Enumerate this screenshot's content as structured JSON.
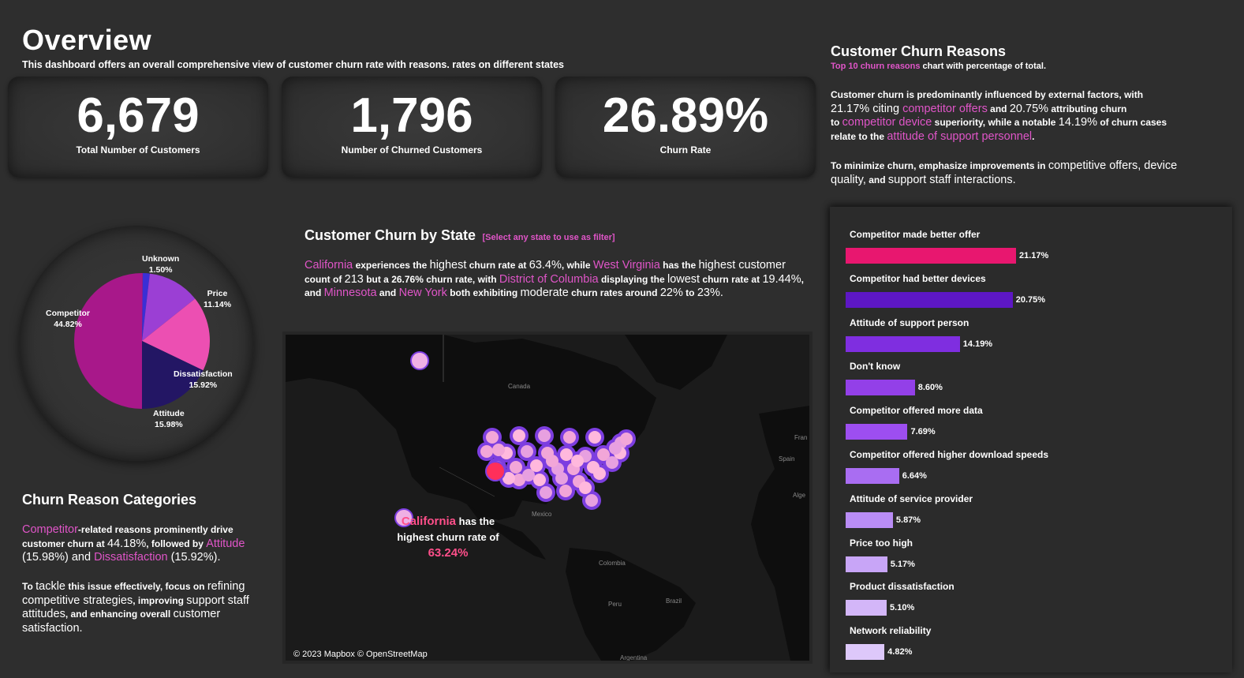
{
  "header": {
    "title": "Overview",
    "subtitle": "This dashboard offers an overall comprehensive view of customer churn rate with reasons. rates on different states"
  },
  "kpis": [
    {
      "value": "6,679",
      "label": "Total Number of Customers"
    },
    {
      "value": "1,796",
      "label": "Number of Churned Customers"
    },
    {
      "value": "26.89%",
      "label": "Churn Rate"
    }
  ],
  "pie": {
    "slices": [
      {
        "name": "Unknown",
        "pct": "1.50%",
        "value": 1.5,
        "color": "#3a2fd6"
      },
      {
        "name": "Price",
        "pct": "11.14%",
        "value": 11.14,
        "color": "#9b3fd4"
      },
      {
        "name": "Dissatisfaction",
        "pct": "15.92%",
        "value": 15.92,
        "color": "#ec4fb2"
      },
      {
        "name": "Attitude",
        "pct": "15.98%",
        "value": 15.98,
        "color": "#231664"
      },
      {
        "name": "Competitor",
        "pct": "44.82%",
        "value": 44.82,
        "color": "#a8188a"
      }
    ]
  },
  "categories": {
    "title": "Churn Reason Categories",
    "p1": {
      "a": "Competitor",
      "b": "-related reasons prominently drive customer churn at ",
      "c": "44.18%",
      "d": ", followed by ",
      "e": "Attitude",
      "f": " (15.98%) and ",
      "g": "Dissatisfaction",
      "h": " (15.92%)."
    },
    "p2": {
      "a": "To ",
      "b": "tackle",
      "c": " this issue effectively, focus on ",
      "d": "refining competitive strategies",
      "e": ", improving ",
      "f": "support staff attitudes",
      "g": ", and enhancing overall ",
      "h": "customer satisfaction."
    }
  },
  "state": {
    "title": "Customer Churn by State",
    "filter_hint": "[Select any state to use as filter]",
    "p": {
      "a": "California",
      "b": " experiences the ",
      "c": "highest",
      "d": " churn rate at ",
      "e": "63.4%",
      "f": ", while ",
      "g": "West Virginia",
      "h": " has the ",
      "i": "highest customer",
      "j": "count of ",
      "k": "213",
      "l": " but a 26.76% churn rate, with ",
      "m": "District of Columbia",
      "n": " displaying the ",
      "o": "lowest",
      "p": " churn rate at ",
      "q": "19.44%",
      "r": ",",
      "s": "and ",
      "t": "Minnesota",
      "u": " and ",
      "v": "New York",
      "w": " both exhibiting ",
      "x": "moderate",
      "y": " churn rates around ",
      "z": "22%",
      "aa": " to ",
      "ab": "23%."
    }
  },
  "map": {
    "annotation_state": "California",
    "annotation_l1": " has the",
    "annotation_l2": "highest churn rate of",
    "annotation_value": "63.24%",
    "credit": "© 2023 Mapbox  © OpenStreetMap",
    "place_labels": [
      "Canada",
      "Mexico",
      "Colombia",
      "Peru",
      "Brazil",
      "Argentina",
      "Spain",
      "Fran",
      "Alge"
    ]
  },
  "reasons": {
    "title": "Customer Churn Reasons",
    "sub_a": "Top 10 churn reasons",
    "sub_b": " chart with percentage of total.",
    "p1": {
      "a": "Customer churn is predominantly influenced by external factors, with",
      "b": "21.17% citing ",
      "c": "competitor offers",
      "d": " and ",
      "e": "20.75%",
      "f": " attributing churn",
      "g": "to ",
      "h": "competitor device",
      "i": " superiority, while a notable ",
      "j": "14.19%",
      "k": " of churn cases",
      "l": "relate to the ",
      "m": "attitude of support personnel",
      "n": "."
    },
    "p2": {
      "a": "To minimize churn, emphasize improvements in ",
      "b": "competitive offers, device",
      "c": "quality,",
      "d": " and ",
      "e": "support staff interactions."
    }
  },
  "chart_data": {
    "type": "bar",
    "categories": [
      "Competitor made better offer",
      "Competitor had better devices",
      "Attitude of support person",
      "Don't know",
      "Competitor offered more data",
      "Competitor offered higher download speeds",
      "Attitude of service provider",
      "Price too high",
      "Product dissatisfaction",
      "Network reliability"
    ],
    "values": [
      21.17,
      20.75,
      14.19,
      8.6,
      7.69,
      6.64,
      5.87,
      5.17,
      5.1,
      4.82
    ],
    "value_labels": [
      "21.17%",
      "20.75%",
      "14.19%",
      "8.60%",
      "7.69%",
      "6.64%",
      "5.87%",
      "5.17%",
      "5.10%",
      "4.82%"
    ],
    "colors": [
      "#e8176f",
      "#5d17c4",
      "#7f2ee0",
      "#9340e8",
      "#9d4ef0",
      "#a96df2",
      "#b98cf5",
      "#c8a5f7",
      "#d3b6f8",
      "#ddc8fa"
    ]
  }
}
